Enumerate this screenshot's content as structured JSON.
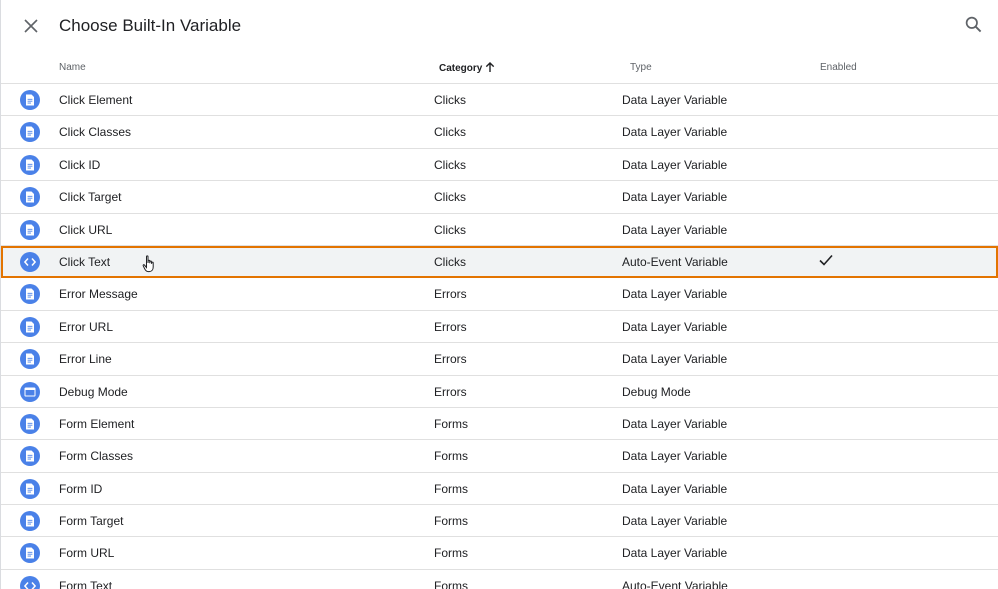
{
  "header": {
    "title": "Choose Built-In Variable"
  },
  "columns": {
    "name": "Name",
    "category": "Category",
    "type": "Type",
    "enabled": "Enabled"
  },
  "rows": [
    {
      "name": "Click Element",
      "category": "Clicks",
      "type": "Data Layer Variable",
      "icon": "document-icon",
      "enabled": false
    },
    {
      "name": "Click Classes",
      "category": "Clicks",
      "type": "Data Layer Variable",
      "icon": "document-icon",
      "enabled": false
    },
    {
      "name": "Click ID",
      "category": "Clicks",
      "type": "Data Layer Variable",
      "icon": "document-icon",
      "enabled": false
    },
    {
      "name": "Click Target",
      "category": "Clicks",
      "type": "Data Layer Variable",
      "icon": "document-icon",
      "enabled": false
    },
    {
      "name": "Click URL",
      "category": "Clicks",
      "type": "Data Layer Variable",
      "icon": "document-icon",
      "enabled": false
    },
    {
      "name": "Click Text",
      "category": "Clicks",
      "type": "Auto-Event Variable",
      "icon": "code-icon",
      "enabled": true,
      "selected": true
    },
    {
      "name": "Error Message",
      "category": "Errors",
      "type": "Data Layer Variable",
      "icon": "document-icon",
      "enabled": false
    },
    {
      "name": "Error URL",
      "category": "Errors",
      "type": "Data Layer Variable",
      "icon": "document-icon",
      "enabled": false
    },
    {
      "name": "Error Line",
      "category": "Errors",
      "type": "Data Layer Variable",
      "icon": "document-icon",
      "enabled": false
    },
    {
      "name": "Debug Mode",
      "category": "Errors",
      "type": "Debug Mode",
      "icon": "window-icon",
      "enabled": false
    },
    {
      "name": "Form Element",
      "category": "Forms",
      "type": "Data Layer Variable",
      "icon": "document-icon",
      "enabled": false
    },
    {
      "name": "Form Classes",
      "category": "Forms",
      "type": "Data Layer Variable",
      "icon": "document-icon",
      "enabled": false
    },
    {
      "name": "Form ID",
      "category": "Forms",
      "type": "Data Layer Variable",
      "icon": "document-icon",
      "enabled": false
    },
    {
      "name": "Form Target",
      "category": "Forms",
      "type": "Data Layer Variable",
      "icon": "document-icon",
      "enabled": false
    },
    {
      "name": "Form URL",
      "category": "Forms",
      "type": "Data Layer Variable",
      "icon": "document-icon",
      "enabled": false
    },
    {
      "name": "Form Text",
      "category": "Forms",
      "type": "Auto-Event Variable",
      "icon": "code-icon",
      "enabled": false
    }
  ],
  "colors": {
    "icon_bg": "#4a81e8",
    "selected_outline": "#e37400",
    "selected_bg": "#f1f3f4"
  }
}
